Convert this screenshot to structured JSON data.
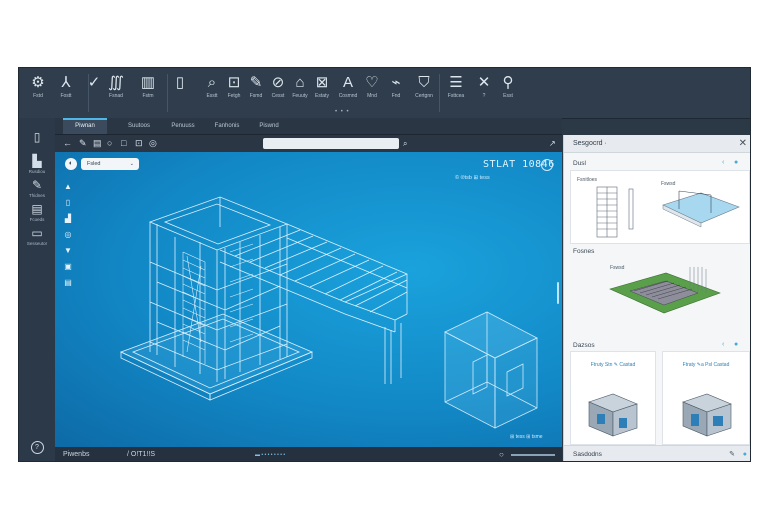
{
  "ribbon": {
    "tools": [
      {
        "icon": "document-gear-icon",
        "glyph": "⚙",
        "label": "Fstd"
      },
      {
        "icon": "axis-icon",
        "glyph": "⅄",
        "label": "Fostt"
      },
      {
        "icon": "check-list-icon",
        "glyph": "✓",
        "label": ""
      },
      {
        "icon": "coil-icon",
        "glyph": "∭",
        "label": "Fsnad"
      },
      {
        "icon": "book-icon",
        "glyph": "▥",
        "label": "Fstm"
      },
      {
        "icon": "clipboard-icon",
        "glyph": "▯",
        "label": ""
      },
      {
        "icon": "search-icon",
        "glyph": "⌕",
        "label": "Esstt"
      },
      {
        "icon": "sheet-icon",
        "glyph": "⊡",
        "label": "Fetgh"
      },
      {
        "icon": "pen-tool-icon",
        "glyph": "✎",
        "label": "Fsmd"
      },
      {
        "icon": "link-icon",
        "glyph": "⊘",
        "label": "Cesst"
      },
      {
        "icon": "tag-icon",
        "glyph": "⌂",
        "label": "Feuuty"
      },
      {
        "icon": "image-icon",
        "glyph": "⊠",
        "label": "Estaty"
      },
      {
        "icon": "letter-a-icon",
        "glyph": "A",
        "label": "Cosmnd"
      },
      {
        "icon": "heart-icon",
        "glyph": "♡",
        "label": "Mnd"
      },
      {
        "icon": "hook-icon",
        "glyph": "⌁",
        "label": "Fnd"
      },
      {
        "icon": "shield-icon",
        "glyph": "⛉",
        "label": "Certgnn"
      },
      {
        "icon": "server-icon",
        "glyph": "☰",
        "label": "Fsttcea"
      },
      {
        "icon": "tools-icon",
        "glyph": "✕",
        "label": "?"
      },
      {
        "icon": "pin-icon",
        "glyph": "⚲",
        "label": "Esst"
      }
    ],
    "more": "• • •"
  },
  "tabs": [
    {
      "label": "Piwnan",
      "active": true
    },
    {
      "label": "Suutoos",
      "active": false
    },
    {
      "label": "Penuuss",
      "active": false
    },
    {
      "label": "Fanhonis",
      "active": false
    },
    {
      "label": "Piswnd",
      "active": false
    }
  ],
  "sidebar": {
    "items": [
      {
        "icon": "panel-icon",
        "glyph": "▯",
        "label": ""
      },
      {
        "icon": "building-icon",
        "glyph": "▙",
        "label": "Rusdiou"
      },
      {
        "icon": "pencil-icon",
        "glyph": "✎",
        "label": "Thidnes"
      },
      {
        "icon": "layers-icon",
        "glyph": "▤",
        "label": "Fcoeds"
      },
      {
        "icon": "monitor-icon",
        "glyph": "▭",
        "label": "Sesseutor"
      }
    ],
    "bottom_icon": "help-circle-icon",
    "bottom_glyph": "?"
  },
  "viewport": {
    "toolbar_icons": [
      "←",
      "✎",
      "▤",
      "○",
      "□",
      "⊡",
      "◎"
    ],
    "address": "",
    "layer_label": "Fsled",
    "title": "STLAT 10846",
    "subtitle": "© ℗tsb  ⊞ tess",
    "coords": "⊞ tess ⊞ tsme",
    "tools": [
      "▲",
      "▯",
      "▟",
      "◎",
      "▼",
      "▣",
      "▤"
    ],
    "status_left": "Piwenbs",
    "status_mid": "/  O!T1!!S",
    "status_dots": "▬ • • • • • • • •"
  },
  "panel": {
    "title": "Sesgocrd  ·",
    "section1": "Dusl",
    "card1_label": "Fsnitloes",
    "card1b_label": "Fswsd",
    "section2": "Fosnes",
    "card2_label": "Fswsd",
    "section3": "Dazsos",
    "card3_title": "Ftruty Stn ✎ Castad",
    "card4_title": "Ftraty ✎a Psl Castad",
    "footer": "Sasdodns"
  }
}
